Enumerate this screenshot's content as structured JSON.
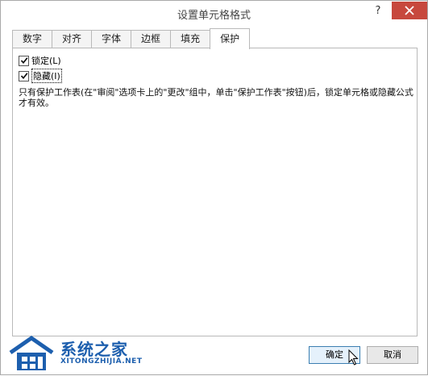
{
  "window": {
    "title": "设置单元格格式",
    "help_label": "?"
  },
  "tabs": [
    {
      "label": "数字"
    },
    {
      "label": "对齐"
    },
    {
      "label": "字体"
    },
    {
      "label": "边框"
    },
    {
      "label": "填充"
    },
    {
      "label": "保护",
      "active": true
    }
  ],
  "protection": {
    "locked_label": "锁定(L)",
    "locked_checked": true,
    "hidden_label": "隐藏(I)",
    "hidden_checked": true,
    "note": "只有保护工作表(在\"审阅\"选项卡上的\"更改\"组中，单击\"保护工作表\"按钮)后，锁定单元格或隐藏公式才有效。"
  },
  "buttons": {
    "ok_label": "确定",
    "cancel_label": "取消"
  },
  "watermark": {
    "name_cn": "系统之家",
    "name_en": "XITONGZHIJIA.NET"
  },
  "colors": {
    "close_button": "#c7483d",
    "watermark_blue": "#1d5fae",
    "ok_border": "#3c7fb1"
  }
}
